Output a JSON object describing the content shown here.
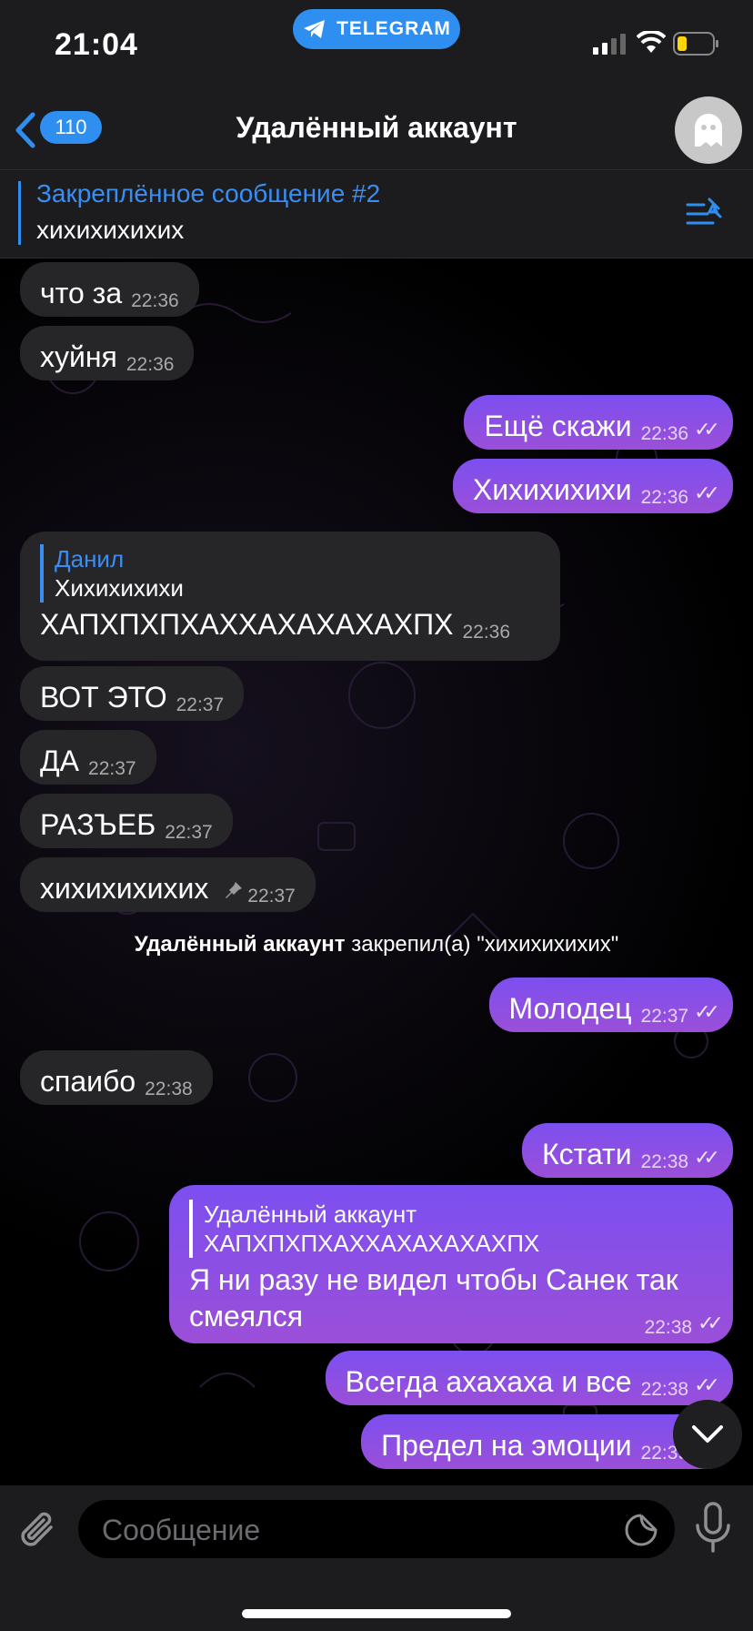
{
  "status_bar": {
    "time": "21:04",
    "telegram_label": "TELEGRAM"
  },
  "nav": {
    "unread_count": "110",
    "title": "Удалённый аккаунт"
  },
  "pinned": {
    "title": "Закреплённое сообщение #2",
    "text": "хихихихихих"
  },
  "messages": [
    {
      "dir": "in",
      "text": "что за",
      "time": "22:36"
    },
    {
      "dir": "in",
      "text": "хуйня",
      "time": "22:36"
    },
    {
      "dir": "out",
      "text": "Ещё скажи",
      "time": "22:36"
    },
    {
      "dir": "out",
      "text": "Хихихихихи",
      "time": "22:36"
    },
    {
      "dir": "in",
      "reply_name": "Данил",
      "reply_text": "Хихихихихи",
      "text": "ХАПХПХПХАХХАХАХАХАХПХ",
      "time": "22:36"
    },
    {
      "dir": "in",
      "text": "ВОТ ЭТО",
      "time": "22:37"
    },
    {
      "dir": "in",
      "text": "ДА",
      "time": "22:37"
    },
    {
      "dir": "in",
      "text": "РАЗЪЕБ",
      "time": "22:37"
    },
    {
      "dir": "in",
      "text": "хихихихихих",
      "time": "22:37"
    },
    {
      "dir": "out",
      "text": "Молодец",
      "time": "22:37"
    },
    {
      "dir": "in",
      "text": "спаибо",
      "time": "22:38"
    },
    {
      "dir": "out",
      "text": "Кстати",
      "time": "22:38"
    },
    {
      "dir": "out",
      "reply_name": "Удалённый аккаунт",
      "reply_text": "ХАПХПХПХАХХАХАХАХАХПХ",
      "text_line1": "Я ни разу не видел чтобы Санек так",
      "text_line2": "смеялся",
      "time": "22:38"
    },
    {
      "dir": "out",
      "text": "Всегда ахахаха и все",
      "time": "22:38"
    },
    {
      "dir": "out",
      "text": "Предел на эмоции",
      "time": "22:39"
    }
  ],
  "service": {
    "actor": "Удалённый аккаунт",
    "action": "закрепил(а) \"хихихихихих\""
  },
  "input": {
    "placeholder": "Сообщение"
  },
  "colors": {
    "accent": "#2f8ff0",
    "outgoing_top": "#7c4ff0",
    "outgoing_bottom": "#9b4fd8",
    "incoming": "#262528"
  },
  "icons": [
    "telegram-icon",
    "cellular-icon",
    "wifi-icon",
    "battery-icon",
    "back-chevron-icon",
    "ghost-icon",
    "pinned-list-icon",
    "pin-icon",
    "read-ticks-icon",
    "scroll-down-icon",
    "attach-icon",
    "sticker-icon",
    "microphone-icon"
  ]
}
